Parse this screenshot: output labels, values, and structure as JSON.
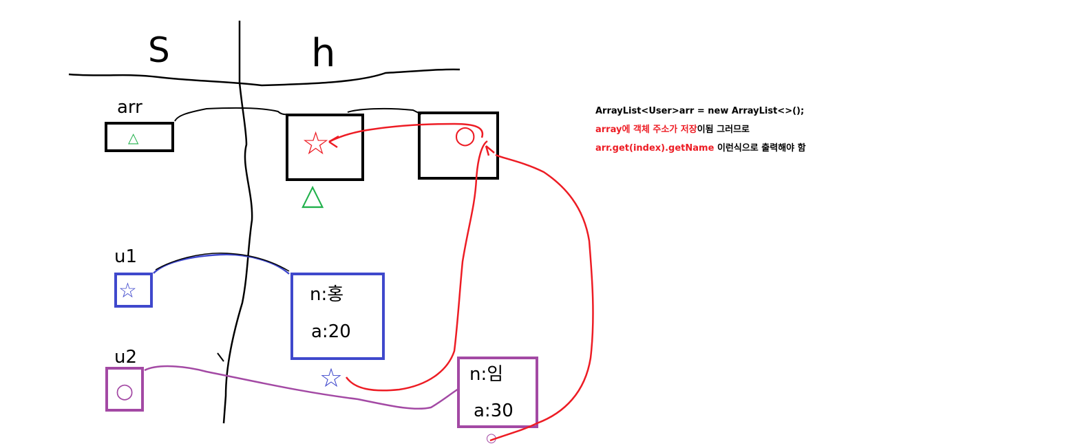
{
  "diagram": {
    "regions": {
      "stack": "S",
      "heap": "h"
    },
    "variables": {
      "arr": {
        "label": "arr",
        "value": "△"
      },
      "u1": {
        "label": "u1",
        "value": "☆"
      },
      "u2": {
        "label": "u2",
        "value": "○"
      }
    },
    "heap_objects": {
      "array_slot_1": {
        "value": "☆",
        "address_mark": "△"
      },
      "array_slot_2": {
        "value": "○"
      },
      "user1": {
        "name_line": "n:홍",
        "age_line": "a:20",
        "address_mark": "☆"
      },
      "user2": {
        "name_line": "n:임",
        "age_line": "a:30",
        "address_mark": "○"
      }
    },
    "colors": {
      "structure": "#000000",
      "array_ref": "#22b14c",
      "slot_ref": "#ed1c24",
      "user1": "#3f48cc",
      "user2": "#a349a4"
    }
  },
  "notes": {
    "line1": "ArrayList<User>arr = new ArrayList<>();",
    "line2_red": "array에 객체 주소가 저장",
    "line2_black": "이됨 그러므로",
    "line3_red": "arr.get(index).getName",
    "line3_black": " 이런식으로 출력해야 함"
  }
}
